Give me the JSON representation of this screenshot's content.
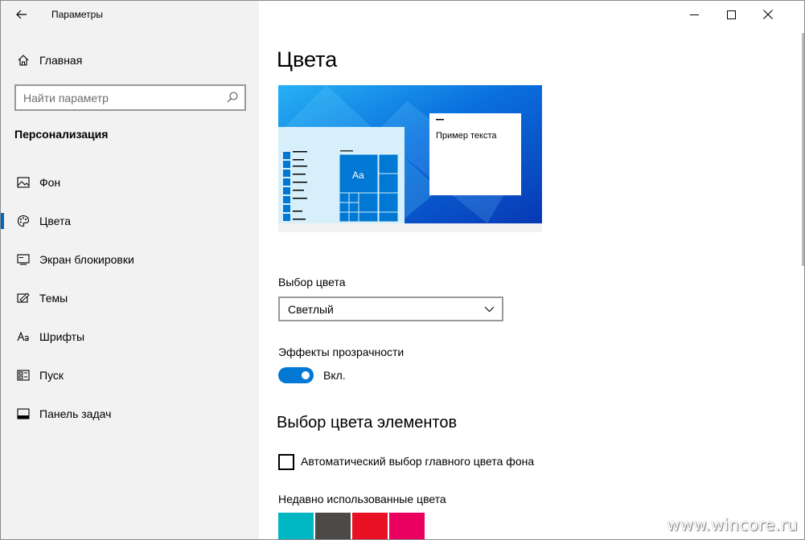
{
  "window": {
    "title": "Параметры",
    "controls": {
      "minimize_icon": "minimize-icon",
      "maximize_icon": "maximize-icon",
      "close_icon": "close-icon"
    }
  },
  "sidebar": {
    "home": {
      "label": "Главная",
      "icon": "home-icon"
    },
    "search": {
      "placeholder": "Найти параметр",
      "icon": "search-icon"
    },
    "section": "Персонализация",
    "items": [
      {
        "label": "Фон",
        "icon": "picture-icon",
        "active": false
      },
      {
        "label": "Цвета",
        "icon": "palette-icon",
        "active": true
      },
      {
        "label": "Экран блокировки",
        "icon": "lock-screen-icon",
        "active": false
      },
      {
        "label": "Темы",
        "icon": "themes-icon",
        "active": false
      },
      {
        "label": "Шрифты",
        "icon": "fonts-icon",
        "active": false
      },
      {
        "label": "Пуск",
        "icon": "start-icon",
        "active": false
      },
      {
        "label": "Панель задач",
        "icon": "taskbar-icon",
        "active": false
      }
    ]
  },
  "main": {
    "title": "Цвета",
    "preview": {
      "sample_text": "Пример текста",
      "tile_text": "Aa"
    },
    "color_choice": {
      "label": "Выбор цвета",
      "selected": "Светлый"
    },
    "transparency": {
      "label": "Эффекты прозрачности",
      "state": "Вкл.",
      "on": true
    },
    "accent_section": {
      "title": "Выбор цвета элементов",
      "auto_checkbox_label": "Автоматический выбор главного цвета фона",
      "auto_checked": false,
      "recent_label": "Недавно использованные цвета",
      "recent_colors": [
        "#00b7c3",
        "#4c4a48",
        "#e81123",
        "#ea005e"
      ]
    }
  },
  "colors": {
    "accent": "#0078d4",
    "sidebar_bg": "#f2f2f2"
  },
  "watermark": "www.wincore.ru"
}
